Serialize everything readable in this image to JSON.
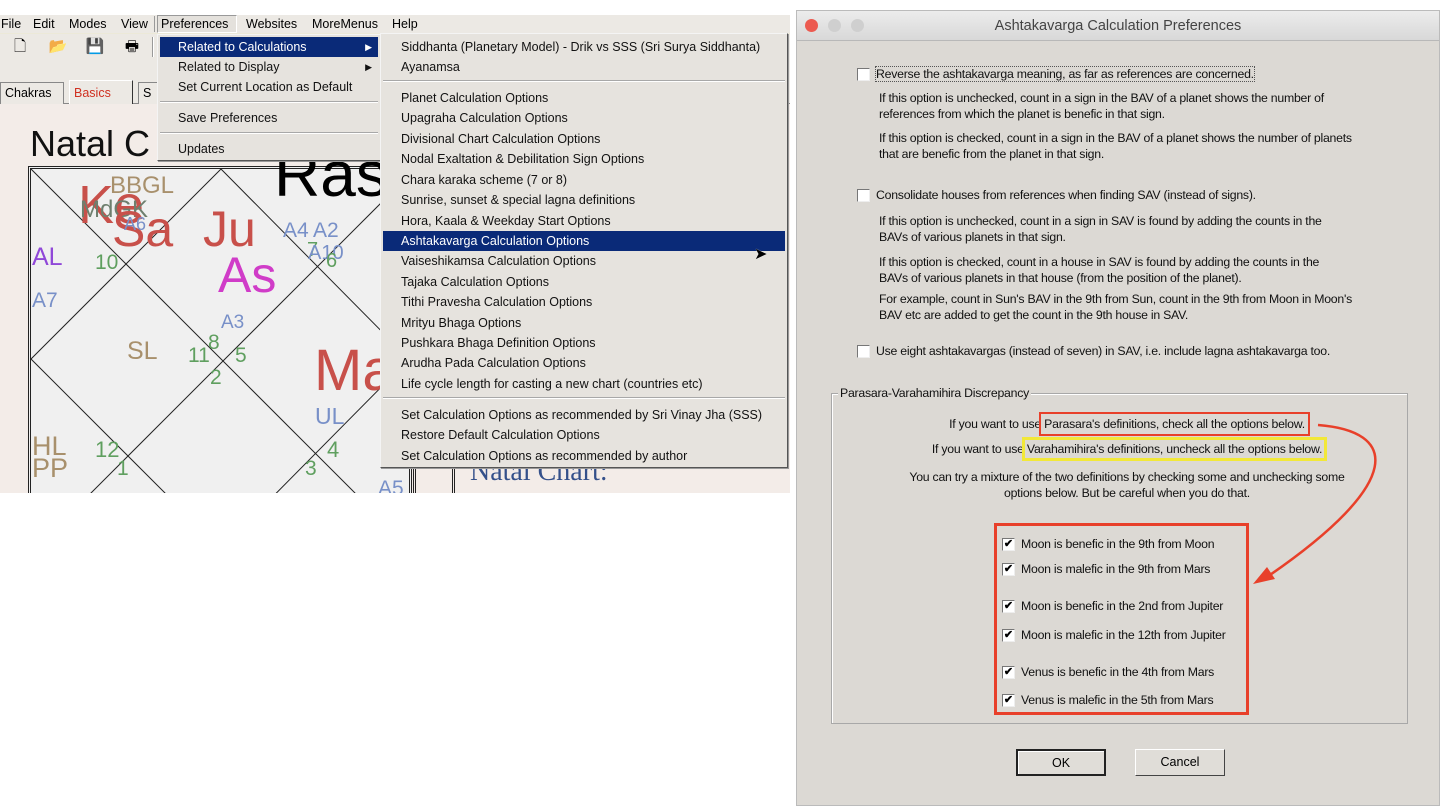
{
  "app": {
    "menubar": [
      "File",
      "Edit",
      "Modes",
      "View",
      "Preferences",
      "Websites",
      "MoreMenus",
      "Help"
    ],
    "toolbar_icons": [
      "new-document-icon",
      "open-folder-icon",
      "save-icon",
      "print-icon"
    ],
    "tabs": [
      "Chakras",
      "Basics",
      "S"
    ],
    "active_tab": "Basics",
    "chart_heading": "Natal C",
    "chart_heading_right": "Ras",
    "natal_chart_label": "Natal Chart:",
    "chart_labels": [
      "BBGL",
      "Ke",
      "MdGK",
      "Sa",
      "A6",
      "Ju",
      "As",
      "A4",
      "A2",
      "7",
      "A10",
      "6",
      "AL",
      "10",
      "A7",
      "A3",
      "SL",
      "11",
      "8",
      "5",
      "2",
      "Ma",
      "UL",
      "HL",
      "PP",
      "12",
      "1",
      "3",
      "4",
      "A5"
    ],
    "preferences_menu": [
      "Related to Calculations",
      "Related to Display",
      "Set Current Location as Default",
      "Save Preferences",
      "Updates"
    ],
    "calculations_submenu": [
      "Siddhanta (Planetary Model) - Drik vs SSS (Sri Surya Siddhanta)",
      "Ayanamsa",
      "Planet Calculation Options",
      "Upagraha Calculation Options",
      "Divisional Chart Calculation Options",
      "Nodal Exaltation & Debilitation Sign Options",
      "Chara karaka scheme (7 or 8)",
      "Sunrise, sunset & special lagna definitions",
      "Hora, Kaala & Weekday Start Options",
      "Ashtakavarga Calculation Options",
      "Vaiseshikamsa Calculation Options",
      "Tajaka Calculation Options",
      "Tithi Pravesha Calculation Options",
      "Mrityu Bhaga Options",
      "Pushkara Bhaga Definition Options",
      "Arudha Pada Calculation Options",
      "Life cycle length for casting a new chart (countries etc)",
      "Set Calculation Options as recommended by Sri Vinay Jha (SSS)",
      "Restore Default Calculation Options",
      "Set Calculation Options as recommended by author"
    ],
    "highlighted_item": "Ashtakavarga Calculation Options"
  },
  "dialog": {
    "title": "Ashtakavarga Calculation Preferences",
    "option1": {
      "label": "Reverse the ashtakavarga meaning, as far as references are concerned.",
      "checked": false,
      "desc": [
        "If this option is unchecked, count in a sign in the BAV of a planet shows the number of",
        "references from which the planet is benefic in that sign.",
        "If this option is checked, count in a sign in the BAV of a planet shows the number of planets",
        "that are benefic from the planet in that sign."
      ]
    },
    "option2": {
      "label": "Consolidate houses from references when finding SAV (instead of signs).",
      "checked": false,
      "desc": [
        "If this option is unchecked, count in a sign in SAV is found by adding the counts in the",
        "BAVs of various planets in that sign.",
        "If this option is checked, count in a house in SAV is found by adding the counts in the",
        "BAVs of various planets in that house (from the position of the planet).",
        "For example, count in Sun's BAV in the 9th from Sun, count in the 9th from Moon in Moon's",
        "BAV etc are added to get the count in the 9th house in SAV."
      ]
    },
    "option3": {
      "label": "Use eight ashtakavargas (instead of seven) in SAV, i.e. include lagna ashtakavarga too.",
      "checked": false
    },
    "group": {
      "title": "Parasara-Varahamihira Discrepancy",
      "line1_prefix": "If you want to use ",
      "line1_highlight": "Parasara's definitions, check all the options below.",
      "line2_prefix": "If you want to use ",
      "line2_highlight": "Varahamihira's definitions, uncheck all the options below.",
      "line3": "You can try a mixture of the two definitions by checking some and unchecking some",
      "line4": "options below. But be careful when you do that.",
      "options": [
        {
          "label": "Moon is benefic in the 9th from Moon",
          "checked": true
        },
        {
          "label": "Moon is malefic in the 9th from Mars",
          "checked": true
        },
        {
          "label": "Moon is benefic in the 2nd from Jupiter",
          "checked": true
        },
        {
          "label": "Moon is malefic in the 12th from Jupiter",
          "checked": true
        },
        {
          "label": "Venus is benefic in the 4th from Mars",
          "checked": true
        },
        {
          "label": "Venus is malefic in the 5th from Mars",
          "checked": true
        }
      ]
    },
    "ok_label": "OK",
    "cancel_label": "Cancel",
    "check_glyph": "✔",
    "annotation_colors": {
      "red": "#e8402a",
      "yellow": "#f2e838"
    }
  }
}
